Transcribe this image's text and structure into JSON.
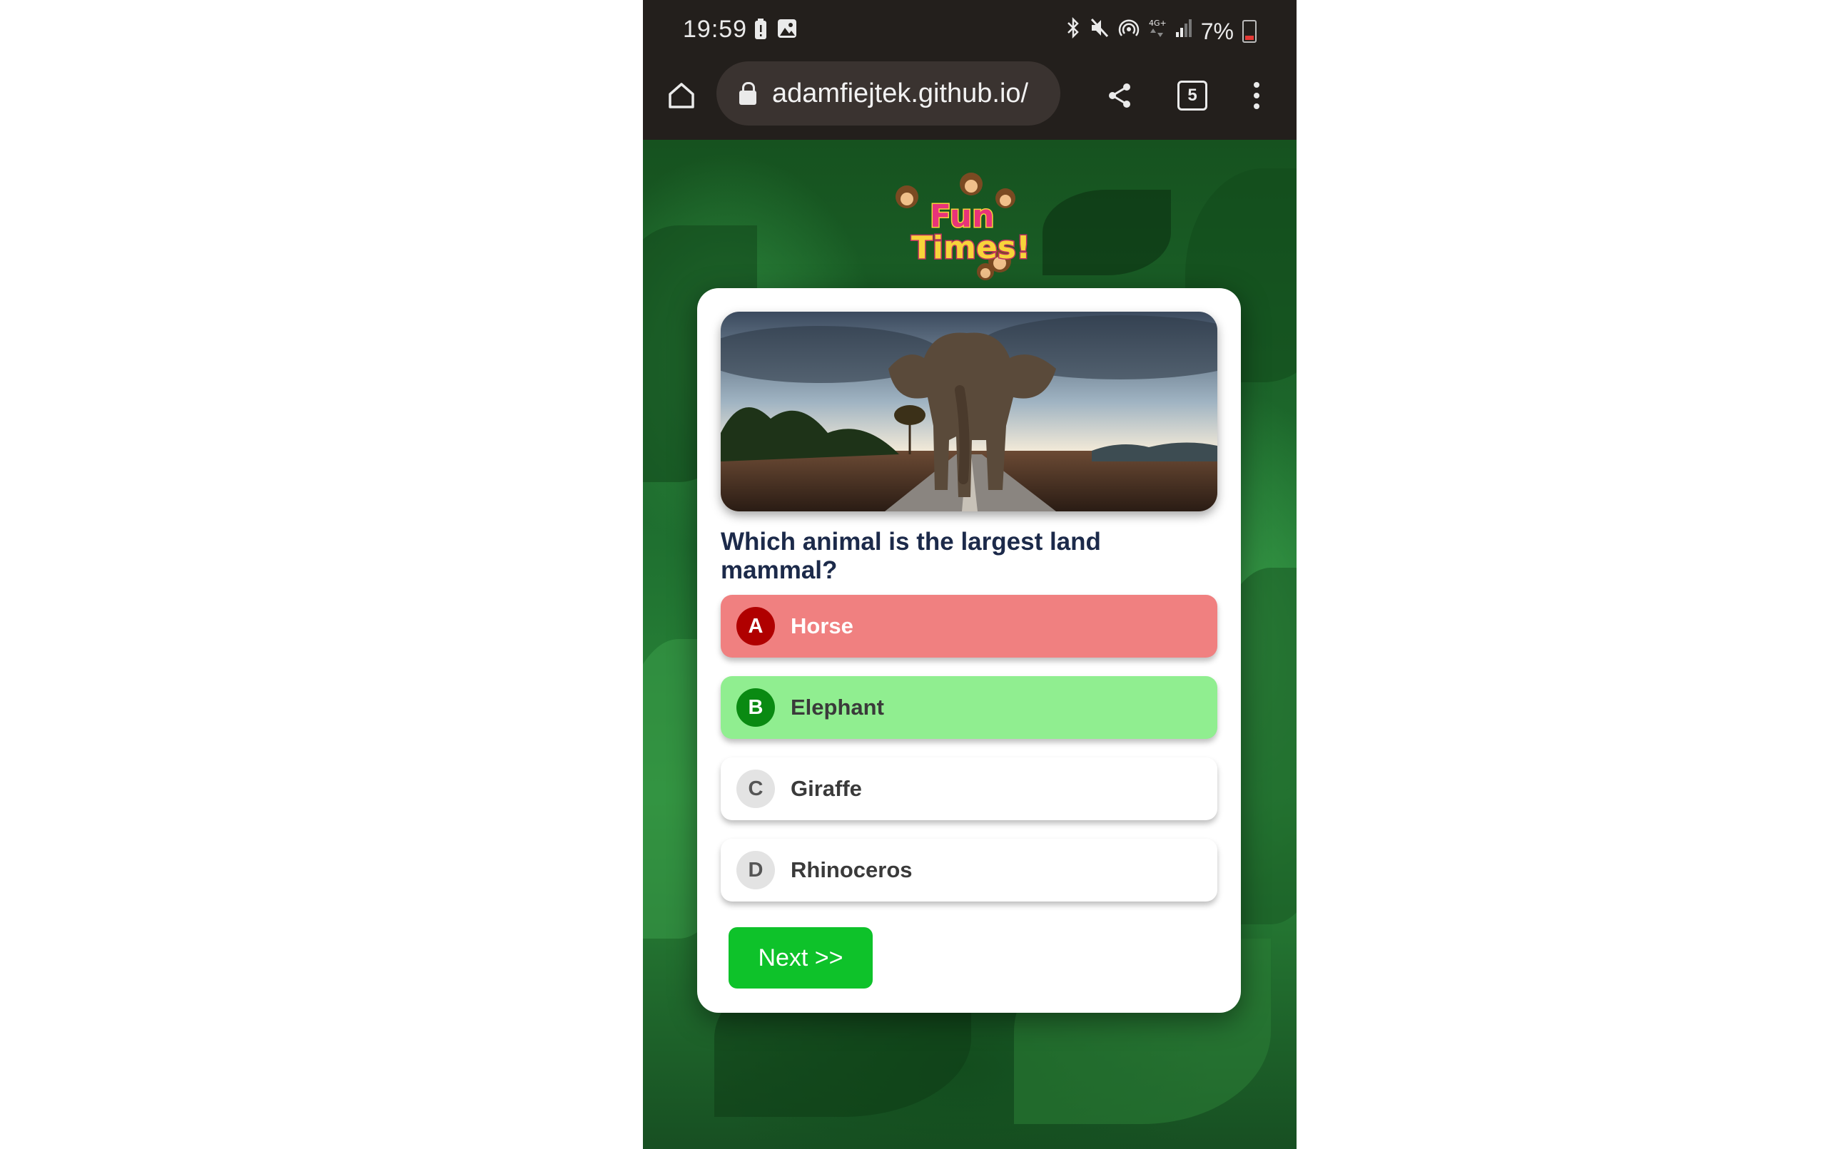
{
  "status_bar": {
    "time": "19:59",
    "battery_percent": "7%",
    "left_icons": [
      "battery-alert-icon",
      "image-icon"
    ],
    "right_icons": [
      "bluetooth-icon",
      "mute-icon",
      "hotspot-icon",
      "4g-icon",
      "signal-icon",
      "battery-icon"
    ]
  },
  "browser": {
    "url": "adamfiejtek.github.io/",
    "tab_count": "5"
  },
  "logo": {
    "line1": "Fun",
    "line2": "Times!"
  },
  "quiz": {
    "question": "Which animal is the largest land mammal?",
    "options": [
      {
        "letter": "A",
        "label": "Horse",
        "state": "incorrect",
        "color": "#f08080"
      },
      {
        "letter": "B",
        "label": "Elephant",
        "state": "correct",
        "color": "#90ee90"
      },
      {
        "letter": "C",
        "label": "Giraffe",
        "state": "neutral",
        "color": "#ffffff"
      },
      {
        "letter": "D",
        "label": "Rhinoceros",
        "state": "neutral",
        "color": "#ffffff"
      }
    ],
    "next_label": "Next >>"
  },
  "colors": {
    "jungle_green": "#1f6b2e",
    "next_button": "#0ec22a",
    "question_text": "#1c2a4a"
  }
}
